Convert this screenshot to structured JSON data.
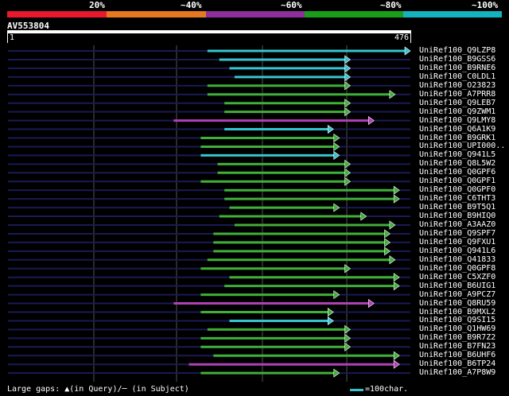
{
  "legend": {
    "labels": [
      "20%",
      "~40%",
      "~60%",
      "~80%",
      "~100%"
    ],
    "bands": [
      {
        "color": "#e8192c",
        "to_pct": 20
      },
      {
        "color": "#e87722",
        "to_pct": 40
      },
      {
        "color": "#8e2f9c",
        "to_pct": 60
      },
      {
        "color": "#1a9e1a",
        "to_pct": 80
      },
      {
        "color": "#13b3c0",
        "to_pct": 100
      }
    ]
  },
  "query": {
    "name": "AV553804",
    "start": "1",
    "end": "476",
    "length": 476
  },
  "colors": {
    "cyan": "#36c5cf",
    "green": "#3fb03a",
    "purple": "#b040b5",
    "background": "#000000",
    "track": "#1a1a55",
    "grid": "#555555"
  },
  "hits": [
    {
      "label": "UniRef100_Q9LZP8",
      "color": "cyan",
      "start": 236,
      "end": 476
    },
    {
      "label": "UniRef100_B9GSS6",
      "color": "cyan",
      "start": 250,
      "end": 405
    },
    {
      "label": "UniRef100_B9RNE6",
      "color": "cyan",
      "start": 262,
      "end": 405
    },
    {
      "label": "UniRef100_C0LDL1",
      "color": "cyan",
      "start": 268,
      "end": 405
    },
    {
      "label": "UniRef100_O23823",
      "color": "green",
      "start": 236,
      "end": 405
    },
    {
      "label": "UniRef100_A7PRR8",
      "color": "green",
      "start": 236,
      "end": 458
    },
    {
      "label": "UniRef100_Q9LEB7",
      "color": "green",
      "start": 256,
      "end": 405
    },
    {
      "label": "UniRef100_Q9ZWM1",
      "color": "green",
      "start": 256,
      "end": 405
    },
    {
      "label": "UniRef100_Q9LMY8",
      "color": "purple",
      "start": 196,
      "end": 433
    },
    {
      "label": "UniRef100_Q6A1K9",
      "color": "cyan",
      "start": 256,
      "end": 385
    },
    {
      "label": "UniRef100_B9GRK1",
      "color": "green",
      "start": 228,
      "end": 392
    },
    {
      "label": "UniRef100_UPI000..",
      "color": "green",
      "start": 228,
      "end": 392
    },
    {
      "label": "UniRef100_Q941L5",
      "color": "cyan",
      "start": 228,
      "end": 392
    },
    {
      "label": "UniRef100_Q8L5W2",
      "color": "green",
      "start": 248,
      "end": 405
    },
    {
      "label": "UniRef100_Q0GPF6",
      "color": "green",
      "start": 248,
      "end": 405
    },
    {
      "label": "UniRef100_Q0GPF1",
      "color": "green",
      "start": 228,
      "end": 405
    },
    {
      "label": "UniRef100_Q0GPF0",
      "color": "green",
      "start": 256,
      "end": 463
    },
    {
      "label": "UniRef100_C6THT3",
      "color": "green",
      "start": 256,
      "end": 463
    },
    {
      "label": "UniRef100_B9T5Q1",
      "color": "green",
      "start": 262,
      "end": 392
    },
    {
      "label": "UniRef100_B9HIQ0",
      "color": "green",
      "start": 250,
      "end": 424
    },
    {
      "label": "UniRef100_A3AAZ0",
      "color": "green",
      "start": 268,
      "end": 458
    },
    {
      "label": "UniRef100_Q9SPF7",
      "color": "green",
      "start": 243,
      "end": 452
    },
    {
      "label": "UniRef100_Q9FXU1",
      "color": "green",
      "start": 243,
      "end": 452
    },
    {
      "label": "UniRef100_Q941L6",
      "color": "green",
      "start": 243,
      "end": 452
    },
    {
      "label": "UniRef100_Q41833",
      "color": "green",
      "start": 236,
      "end": 458
    },
    {
      "label": "UniRef100_Q0GPF8",
      "color": "green",
      "start": 228,
      "end": 405
    },
    {
      "label": "UniRef100_C5XZF0",
      "color": "green",
      "start": 262,
      "end": 463
    },
    {
      "label": "UniRef100_B6UIG1",
      "color": "green",
      "start": 256,
      "end": 463
    },
    {
      "label": "UniRef100_A9PCZ7",
      "color": "green",
      "start": 228,
      "end": 392
    },
    {
      "label": "UniRef100_Q8RU59",
      "color": "purple",
      "start": 196,
      "end": 433
    },
    {
      "label": "UniRef100_B9MXL2",
      "color": "green",
      "start": 228,
      "end": 385
    },
    {
      "label": "UniRef100_Q9SI15",
      "color": "cyan",
      "start": 262,
      "end": 385
    },
    {
      "label": "UniRef100_Q1HW69",
      "color": "green",
      "start": 236,
      "end": 405
    },
    {
      "label": "UniRef100_B9R7Z2",
      "color": "green",
      "start": 228,
      "end": 405
    },
    {
      "label": "UniRef100_B7FN23",
      "color": "green",
      "start": 228,
      "end": 405
    },
    {
      "label": "UniRef100_B6UHF6",
      "color": "green",
      "start": 243,
      "end": 463
    },
    {
      "label": "UniRef100_B6TP24",
      "color": "purple",
      "start": 214,
      "end": 463
    },
    {
      "label": "UniRef100_A7P8W9",
      "color": "green",
      "start": 228,
      "end": 392
    }
  ],
  "footer": {
    "gap_note": "Large gaps: ▲(in Query)/─ (in Subject)",
    "scale_label": "=100char."
  }
}
